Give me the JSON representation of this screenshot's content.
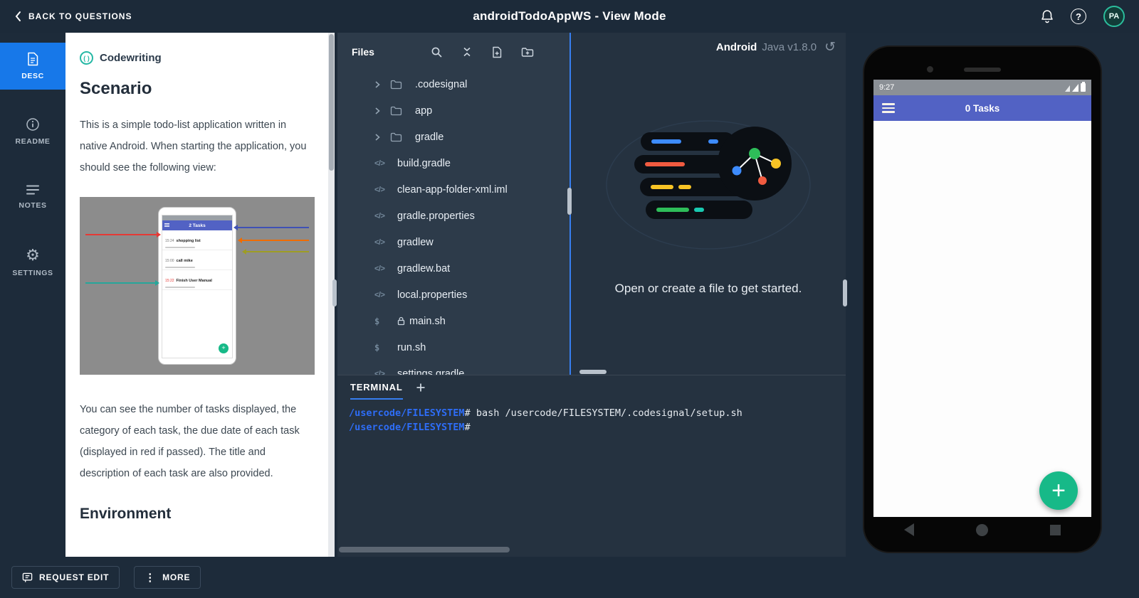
{
  "topbar": {
    "back_label": "BACK TO QUESTIONS",
    "title": "androidTodoAppWS - View Mode",
    "avatar_initials": "PA"
  },
  "sidebar": {
    "items": [
      {
        "label": "DESC"
      },
      {
        "label": "README"
      },
      {
        "label": "NOTES"
      },
      {
        "label": "SETTINGS"
      }
    ]
  },
  "description": {
    "type_label": "Codewriting",
    "scenario_heading": "Scenario",
    "paragraph1": "This is a simple todo-list application written in native Android. When starting the application, you should see the following view:",
    "figure": {
      "appbar_label": "2 Tasks",
      "tasks": [
        {
          "time": "15:24",
          "title": "shopping list"
        },
        {
          "time": "15:00",
          "title": "call mike"
        },
        {
          "time": "15:22",
          "title": "Finish User Manual"
        }
      ]
    },
    "paragraph2": "You can see the number of tasks displayed, the category of each task, the due date of each task (displayed in red if passed). The title and description of each task are also provided.",
    "environment_heading": "Environment"
  },
  "files": {
    "title": "Files",
    "items": [
      {
        "name": ".codesignal"
      },
      {
        "name": "app"
      },
      {
        "name": "gradle"
      },
      {
        "name": "build.gradle"
      },
      {
        "name": "clean-app-folder-xml.iml"
      },
      {
        "name": "gradle.properties"
      },
      {
        "name": "gradlew"
      },
      {
        "name": "gradlew.bat"
      },
      {
        "name": "local.properties"
      },
      {
        "name": "main.sh"
      },
      {
        "name": "run.sh"
      },
      {
        "name": "settings.gradle"
      }
    ]
  },
  "editor": {
    "runtime_name": "Android",
    "runtime_version": "Java v1.8.0",
    "empty_message": "Open or create a file to get started."
  },
  "terminal": {
    "tab_label": "TERMINAL",
    "lines": [
      {
        "prompt": "/usercode/FILESYSTEM",
        "hash": "#",
        "command": " bash /usercode/FILESYSTEM/.codesignal/setup.sh"
      },
      {
        "prompt": "/usercode/FILESYSTEM",
        "hash": "#",
        "command": ""
      }
    ]
  },
  "emulator": {
    "status_time": "9:27",
    "app_title": "0 Tasks",
    "fab_label": "+"
  },
  "bottombar": {
    "request_edit_label": "REQUEST EDIT",
    "more_label": "MORE"
  },
  "colors": {
    "accent_blue": "#377ef0",
    "active_nav_blue": "#1778e9",
    "fab_green": "#17b988",
    "emulator_appbar_indigo": "#5262c4",
    "terminal_prompt_blue": "#2e6df6",
    "codewriting_teal": "#26b8a5"
  }
}
